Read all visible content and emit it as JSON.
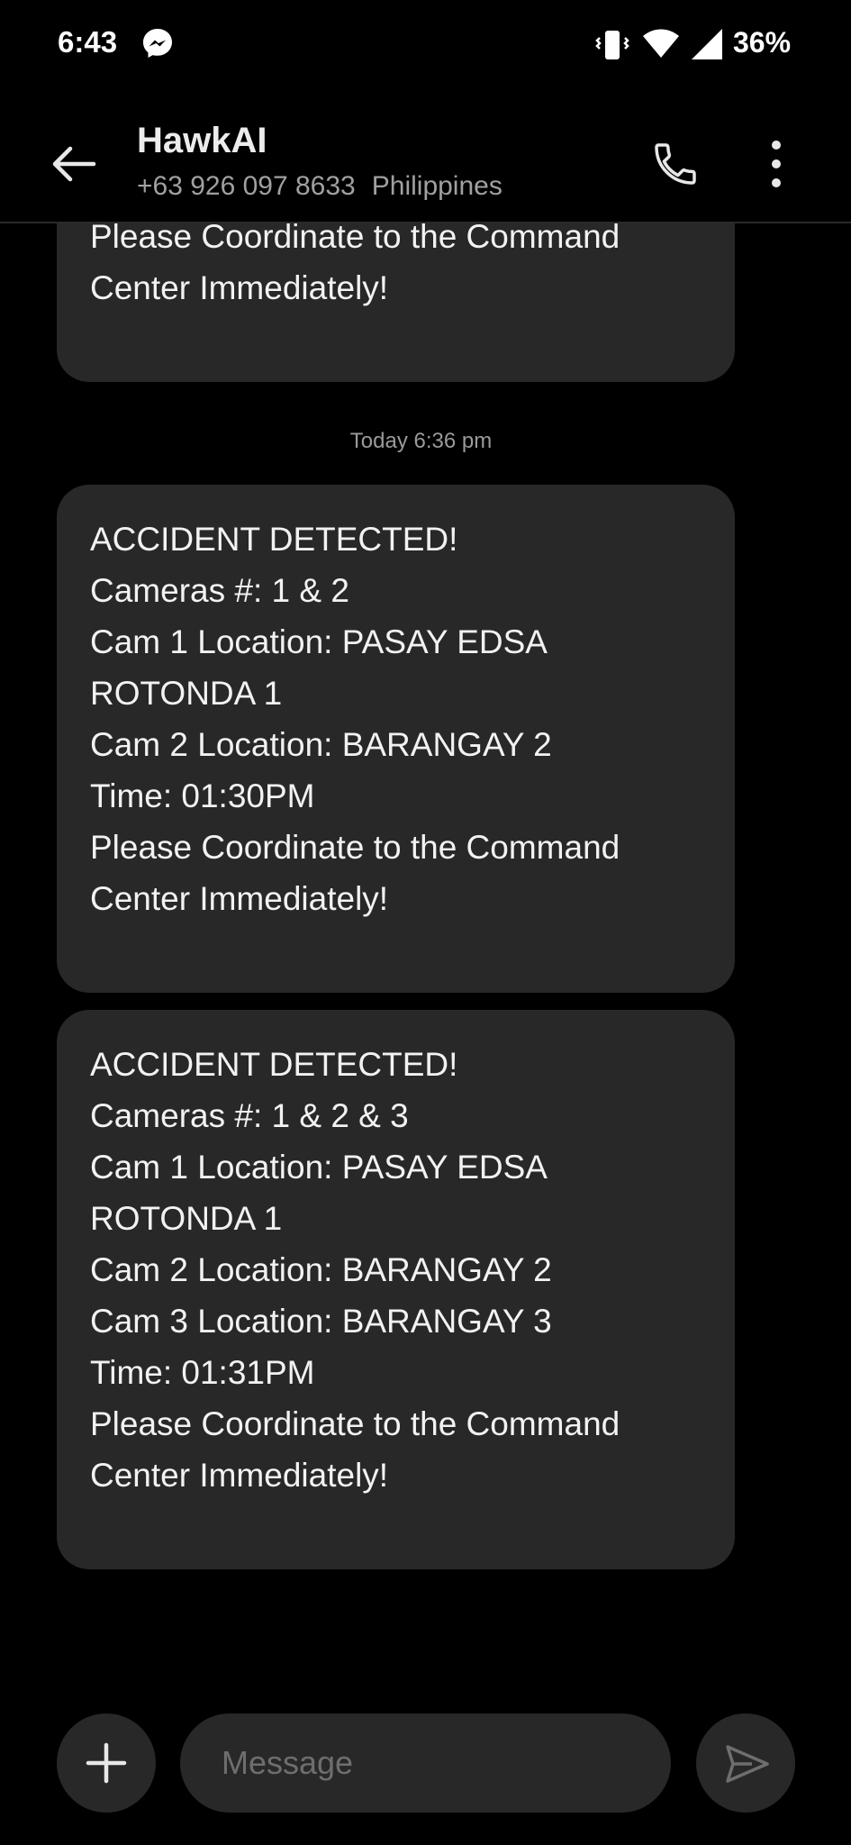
{
  "status_bar": {
    "time": "6:43",
    "battery": "36%",
    "icons": [
      "messenger-icon",
      "vibrate-icon",
      "wifi-icon",
      "signal-icon"
    ]
  },
  "header": {
    "contact_name": "HawkAI",
    "phone": "+63 926 097 8633",
    "country": "Philippines",
    "icons": [
      "back-arrow-icon",
      "phone-icon",
      "more-vert-icon"
    ]
  },
  "conversation": {
    "partial_message": {
      "lines": [
        "Please Coordinate to the Command",
        "Center Immediately!"
      ]
    },
    "timestamp": "Today 6:36 pm",
    "messages": [
      {
        "lines": [
          "ACCIDENT DETECTED!",
          "Cameras #: 1 & 2",
          "Cam 1 Location: PASAY EDSA",
          "ROTONDA 1",
          "Cam 2 Location: BARANGAY 2",
          "Time: 01:30PM",
          "Please Coordinate to the Command",
          "Center Immediately!"
        ]
      },
      {
        "lines": [
          "ACCIDENT DETECTED!",
          "Cameras #: 1 & 2 & 3",
          "Cam 1 Location: PASAY EDSA",
          "ROTONDA 1",
          "Cam 2 Location: BARANGAY 2",
          "Cam 3 Location: BARANGAY 3",
          "Time: 01:31PM",
          "Please Coordinate to the Command",
          "Center Immediately!"
        ]
      }
    ]
  },
  "compose": {
    "placeholder": "Message",
    "icons": [
      "plus-icon",
      "send-icon"
    ]
  },
  "colors": {
    "background": "#000000",
    "bubble": "#282828",
    "text": "#f2f2f2",
    "secondary_text": "#a0a0a0"
  }
}
